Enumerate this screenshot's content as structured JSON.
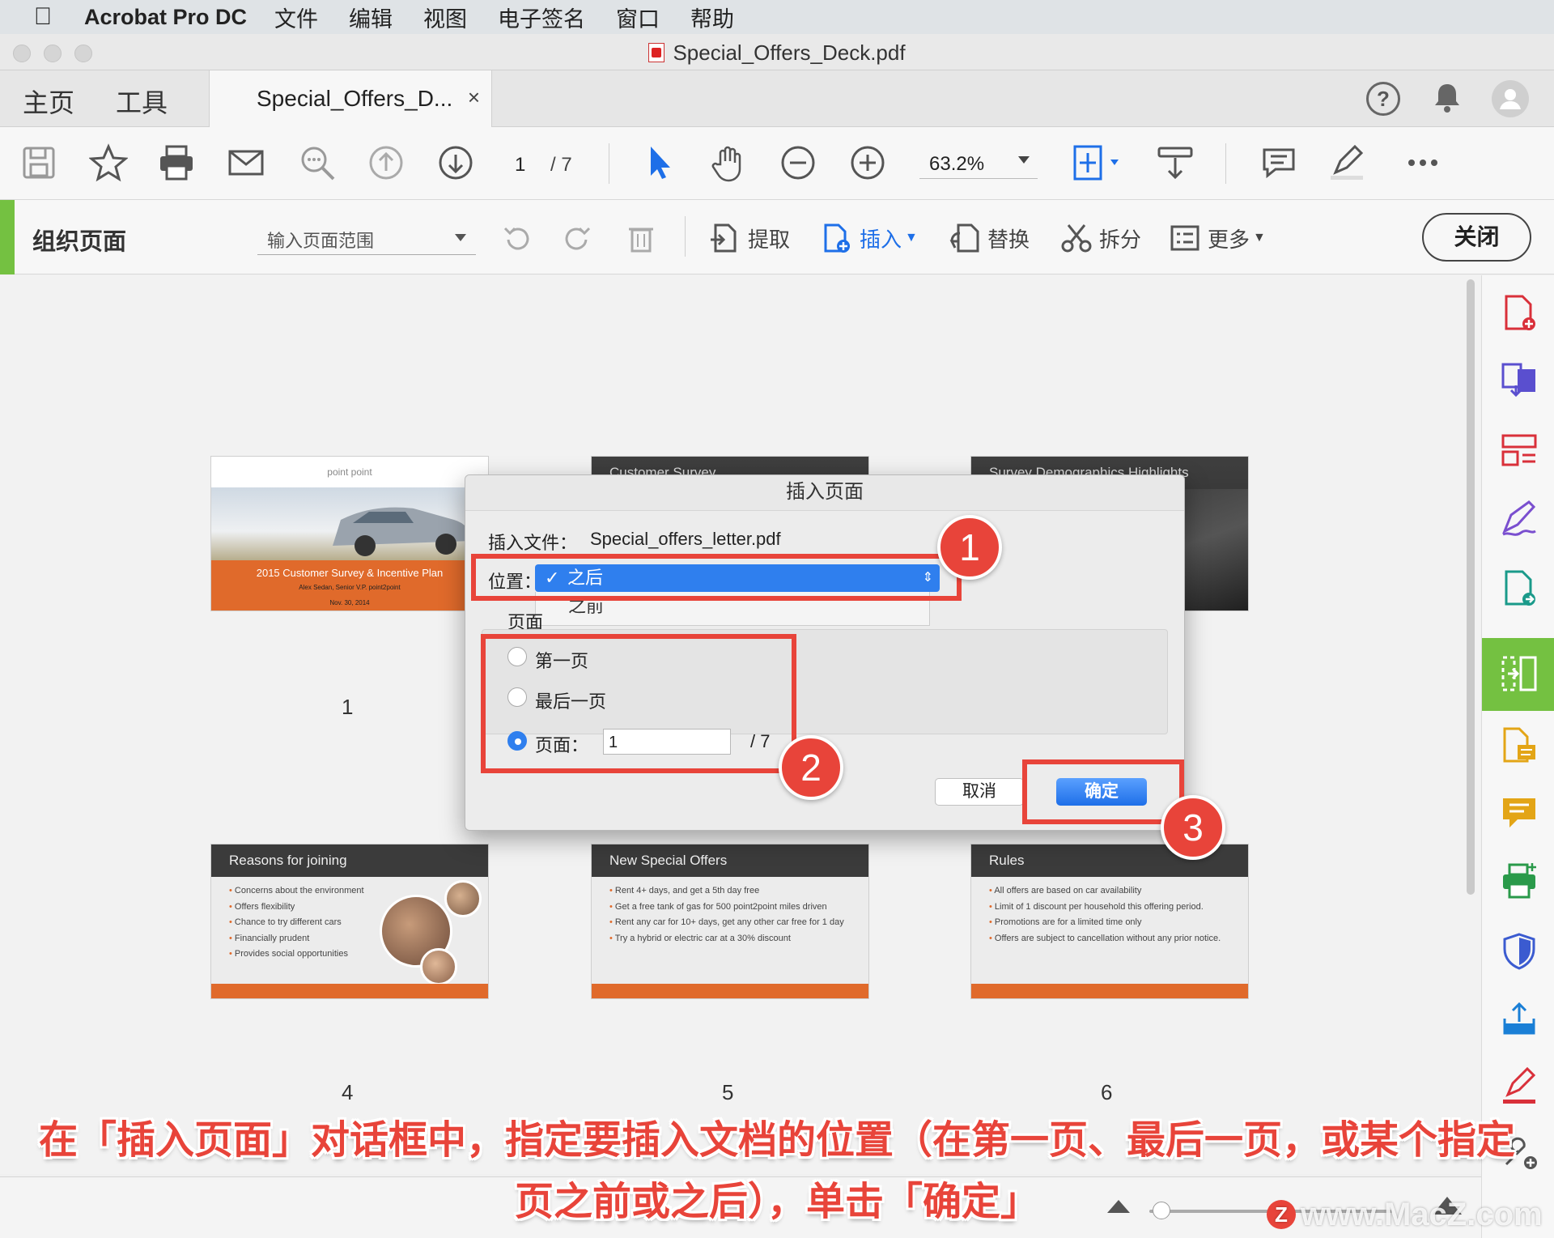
{
  "menubar": {
    "app_name": "Acrobat Pro DC",
    "items": [
      "文件",
      "编辑",
      "视图",
      "电子签名",
      "窗口",
      "帮助"
    ]
  },
  "window": {
    "title": "Special_Offers_Deck.pdf"
  },
  "tabs": {
    "home": "主页",
    "tools": "工具",
    "document": "Special_Offers_D...",
    "close_symbol": "×"
  },
  "toolbar": {
    "page_current": "1",
    "page_total": "/ 7",
    "zoom": "63.2%"
  },
  "organize": {
    "title": "组织页面",
    "range_placeholder": "输入页面范围",
    "extract": "提取",
    "insert": "插入",
    "replace": "替换",
    "split": "拆分",
    "more": "更多",
    "close": "关闭"
  },
  "thumbnails": [
    {
      "number": "1",
      "header": "",
      "subtitle": "2015 Customer Survey & Incentive Plan",
      "author": "Alex Sedan, Senior V.P. point2point",
      "date": "Nov. 30, 2014",
      "logo": "point  point"
    },
    {
      "number": "",
      "header": "Customer Survey"
    },
    {
      "number": "",
      "header": "Survey Demographics Highlights"
    },
    {
      "number": "4",
      "header": "Reasons for joining",
      "bullets": [
        "Concerns about the environment",
        "Offers flexibility",
        "Chance to try different cars",
        "Financially prudent",
        "Provides social opportunities"
      ]
    },
    {
      "number": "5",
      "header": "New Special Offers",
      "bullets": [
        "Rent 4+ days, and get a 5th day free",
        "Get a free tank of gas for 500 point2point miles driven",
        "Rent any car for 10+ days, get any other car free for 1 day",
        "Try a hybrid or electric car at a 30% discount"
      ]
    },
    {
      "number": "6",
      "header": "Rules",
      "bullets": [
        "All offers are based on car availability",
        "Limit of 1 discount per household this offering period.",
        "Promotions are for a limited time only",
        "Offers are subject to cancellation without any prior notice."
      ]
    }
  ],
  "dialog": {
    "title": "插入页面",
    "file_label": "插入文件：",
    "file_name": "Special_offers_letter.pdf",
    "position_label": "位置：",
    "position_selected": "之后",
    "position_option_other": "之前",
    "page_label": "页面",
    "radio_first": "第一页",
    "radio_last": "最后一页",
    "radio_page": "页面：",
    "page_value": "1",
    "page_total": "/ 7",
    "cancel": "取消",
    "ok": "确定"
  },
  "callouts": [
    "1",
    "2",
    "3"
  ],
  "caption": {
    "line1": "在「插入页面」对话框中，指定要插入文档的位置（在第一页、最后一页，或某个指定",
    "line2": "页之前或之后），单击「确定」"
  },
  "watermark": "www.MacZ.com",
  "colors": {
    "accent_green": "#74c141",
    "highlight_red": "#e8443a",
    "select_blue": "#2f7fee",
    "acrobat_blue": "#1e6fe8"
  }
}
